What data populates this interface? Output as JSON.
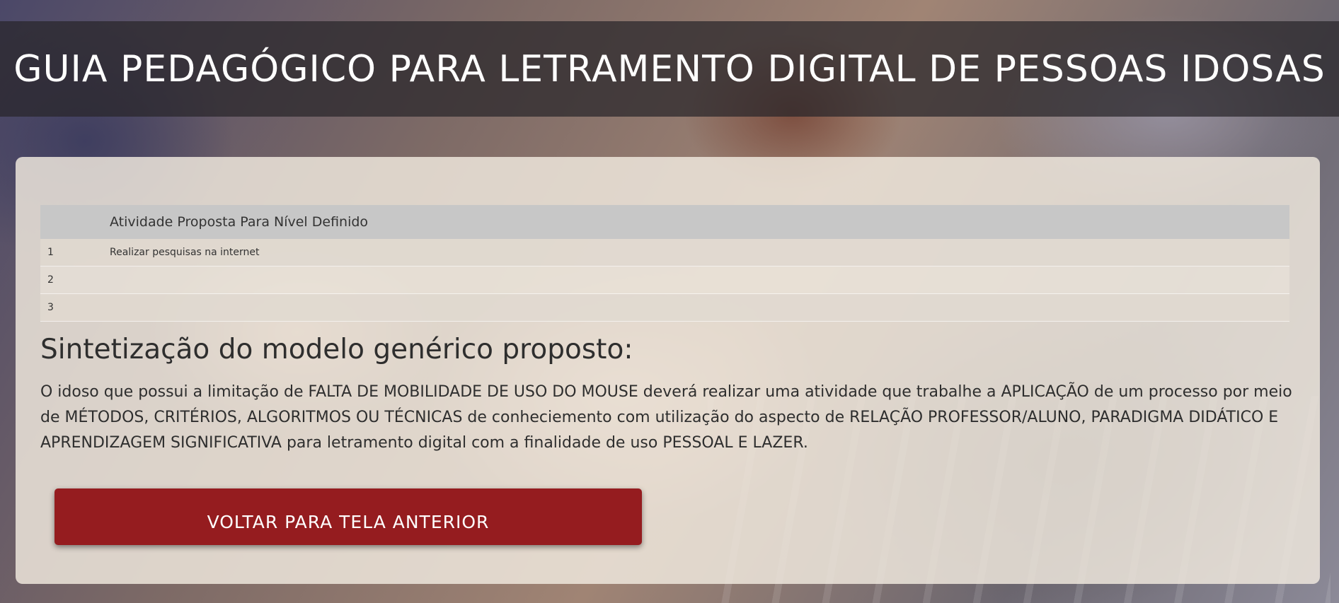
{
  "header": {
    "title": "GUIA PEDAGÓGICO PARA LETRAMENTO DIGITAL DE PESSOAS IDOSAS"
  },
  "activities_table": {
    "column_header": "Atividade Proposta Para Nível Definido",
    "rows": [
      {
        "number": "1",
        "activity": "Realizar pesquisas na internet"
      },
      {
        "number": "2",
        "activity": ""
      },
      {
        "number": "3",
        "activity": ""
      }
    ]
  },
  "synthesis": {
    "heading": "Sintetização do modelo genérico proposto:",
    "text": "O idoso que possui a limitação de FALTA DE MOBILIDADE DE USO DO MOUSE deverá realizar uma atividade que trabalhe a APLICAÇÃO de um processo por meio de MÉTODOS, CRITÉRIOS, ALGORITMOS OU TÉCNICAS de conheciemento com utilização do aspecto de RELAÇÃO PROFESSOR/ALUNO, PARADIGMA DIDÁTICO E APRENDIZAGEM SIGNIFICATIVA para letramento digital com a finalidade de uso PESSOAL E LAZER."
  },
  "actions": {
    "back_label": "VOLTAR PARA TELA ANTERIOR"
  },
  "colors": {
    "button_bg": "#951c1f",
    "table_header_bg": "#c7c7c7",
    "title_band_bg": "rgba(40,38,42,0.72)"
  }
}
